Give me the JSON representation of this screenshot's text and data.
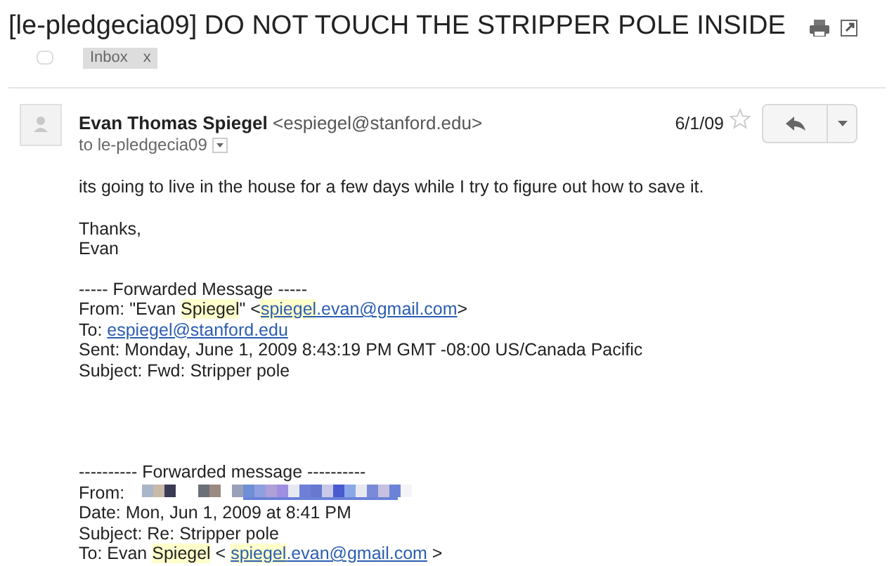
{
  "subject": "[le-pledgecia09] DO NOT TOUCH THE STRIPPER POLE INSIDE",
  "labels": [
    {
      "label": "Inbox",
      "remove": "x"
    }
  ],
  "message": {
    "sender_name": "Evan Thomas Spiegel",
    "sender_email": "<espiegel@stanford.edu>",
    "recipients": "to le-pledgecia09",
    "date": "6/1/09",
    "starred": false,
    "blocks": [
      [
        [
          {
            "kind": "text",
            "text": "its going to live in the house for a few days while I try to figure out how to save it."
          }
        ]
      ],
      [
        [
          {
            "kind": "text",
            "text": "Thanks,"
          }
        ],
        [
          {
            "kind": "text",
            "text": "Evan"
          }
        ]
      ],
      [
        [
          {
            "kind": "text",
            "text": "----- Forwarded Message -----"
          }
        ],
        [
          {
            "kind": "text",
            "text": "From: \"Evan "
          },
          {
            "kind": "text",
            "text": "Spiegel",
            "highlight": true
          },
          {
            "kind": "text",
            "text": "\" <"
          },
          {
            "kind": "text",
            "text": "spiegel",
            "highlight": true,
            "link": true
          },
          {
            "kind": "text",
            "text": ".evan@gmail.com",
            "link": true
          },
          {
            "kind": "text",
            "text": ">"
          }
        ],
        [
          {
            "kind": "text",
            "text": "To: "
          },
          {
            "kind": "text",
            "text": "espiegel@stanford.edu",
            "link": true
          }
        ],
        [
          {
            "kind": "text",
            "text": "Sent: Monday, June 1, 2009 8:43:19 PM GMT -08:00 US/Canada Pacific"
          }
        ],
        [
          {
            "kind": "text",
            "text": "Subject: Fwd: Stripper pole"
          }
        ]
      ],
      [
        [
          {
            "kind": "text",
            "text": "---------- Forwarded message ----------"
          }
        ],
        [
          {
            "kind": "text",
            "text": "From:"
          },
          {
            "kind": "redacted"
          }
        ],
        [
          {
            "kind": "text",
            "text": "Date: Mon, Jun 1, 2009 at 8:41 PM"
          }
        ],
        [
          {
            "kind": "text",
            "text": "Subject: Re: Stripper pole"
          }
        ],
        [
          {
            "kind": "text",
            "text": "To: Evan "
          },
          {
            "kind": "text",
            "text": "Spiegel",
            "highlight": true
          },
          {
            "kind": "text",
            "text": " < "
          },
          {
            "kind": "text",
            "text": "spiegel",
            "highlight": true,
            "link": true
          },
          {
            "kind": "text",
            "text": ".evan@gmail.com",
            "link": true
          },
          {
            "kind": "text",
            "text": " >"
          }
        ]
      ]
    ]
  }
}
